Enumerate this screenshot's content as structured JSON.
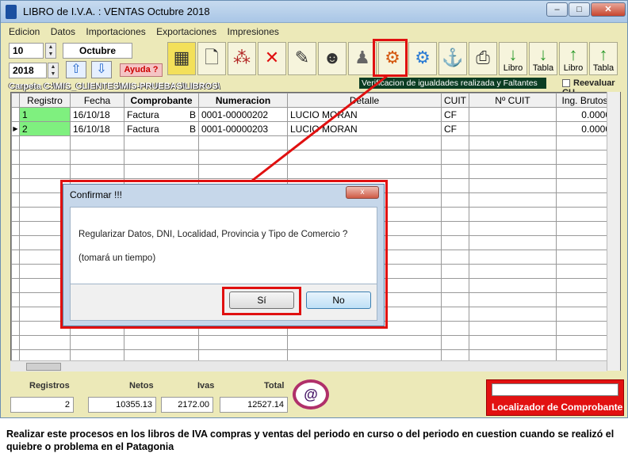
{
  "window": {
    "title": "LIBRO de I.V.A. : VENTAS Octubre 2018",
    "min": "–",
    "max": "□",
    "close": "✕"
  },
  "menu": [
    "Edicion",
    "Datos",
    "Importaciones",
    "Exportaciones",
    "Impresiones"
  ],
  "period": {
    "month_num": "10",
    "month_name": "Octubre",
    "year": "2018"
  },
  "toolbar": {
    "ayuda": "Ayuda ?",
    "libro1": "Libro",
    "tabla1": "Tabla",
    "libro2": "Libro",
    "tabla2": "Tabla"
  },
  "tooltip": "Verificacion de igualdades realizada y Faltantes",
  "reevaluar": "Reevaluar CU",
  "carpeta": "Carpeta C:\\MIS_CLIENTES\\MIS-PRUEBAS\\LIBROS\\",
  "grid": {
    "headers": [
      "Registro",
      "Fecha",
      "Comprobante",
      "Numeracion",
      "Detalle",
      "CUIT",
      "Nº CUIT",
      "Ing. Brutos"
    ],
    "rows": [
      {
        "registro": "1",
        "fecha": "16/10/18",
        "comprobante": "Factura",
        "letra": "B",
        "numeracion": "0001-00000202",
        "detalle": "LUCIO MORAN",
        "cuit": "CF",
        "ncuit": "",
        "ib": "0.0000"
      },
      {
        "registro": "2",
        "fecha": "16/10/18",
        "comprobante": "Factura",
        "letra": "B",
        "numeracion": "0001-00000203",
        "detalle": "LUCIO MORAN",
        "cuit": "CF",
        "ncuit": "",
        "ib": "0.0000"
      }
    ]
  },
  "totals": {
    "registros_label": "Registros",
    "registros": "2",
    "netos_label": "Netos",
    "netos": "10355.13",
    "ivas_label": "Ivas",
    "ivas": "2172.00",
    "total_label": "Total",
    "total": "12527.14"
  },
  "localizador": "Localizador de Comprobante",
  "dialog": {
    "title": "Confirmar !!!",
    "close": "x",
    "message": "Regularizar Datos, DNI, Localidad, Provincia y Tipo de Comercio ?",
    "note": "(tomará un tiempo)",
    "yes": "Sí",
    "no": "No"
  },
  "caption": "Realizar este procesos en los libros de IVA compras y ventas del periodo en curso o del periodo en cuestion cuando se realizó el quiebre o problema en el Patagonia",
  "colors": {
    "highlight": "#e01010",
    "registro_cell": "#7ff07f",
    "localizador_bg": "#e21111"
  }
}
